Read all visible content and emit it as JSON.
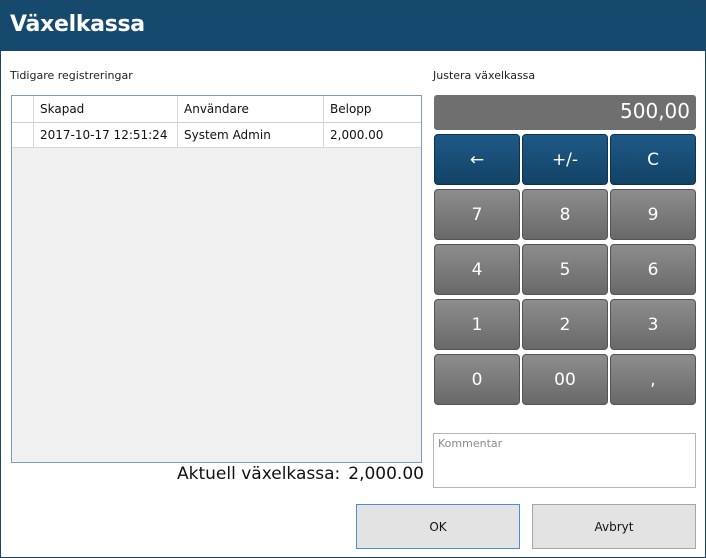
{
  "window": {
    "title": "Växelkassa"
  },
  "history": {
    "label": "Tidigare registreringar",
    "columns": [
      "Skapad",
      "Användare",
      "Belopp"
    ],
    "rows": [
      {
        "created": "2017-10-17 12:51:24",
        "user": "System Admin",
        "amount": "2,000.00"
      }
    ]
  },
  "current": {
    "label": "Aktuell växelkassa:",
    "value": "2,000.00"
  },
  "adjust": {
    "label": "Justera växelkassa",
    "display": "500,00",
    "keys": {
      "backspace": "←",
      "sign": "+/-",
      "clear": "C",
      "k7": "7",
      "k8": "8",
      "k9": "9",
      "k4": "4",
      "k5": "5",
      "k6": "6",
      "k1": "1",
      "k2": "2",
      "k3": "3",
      "k0": "0",
      "k00": "00",
      "comma": ","
    }
  },
  "comment": {
    "placeholder": "Kommentar",
    "value": ""
  },
  "actions": {
    "ok": "OK",
    "cancel": "Avbryt"
  },
  "colors": {
    "title_bar": "#154a6e",
    "key_dark": "#1d5a86",
    "key_gray": "#7a7a7a",
    "display": "#6f6f6f"
  }
}
